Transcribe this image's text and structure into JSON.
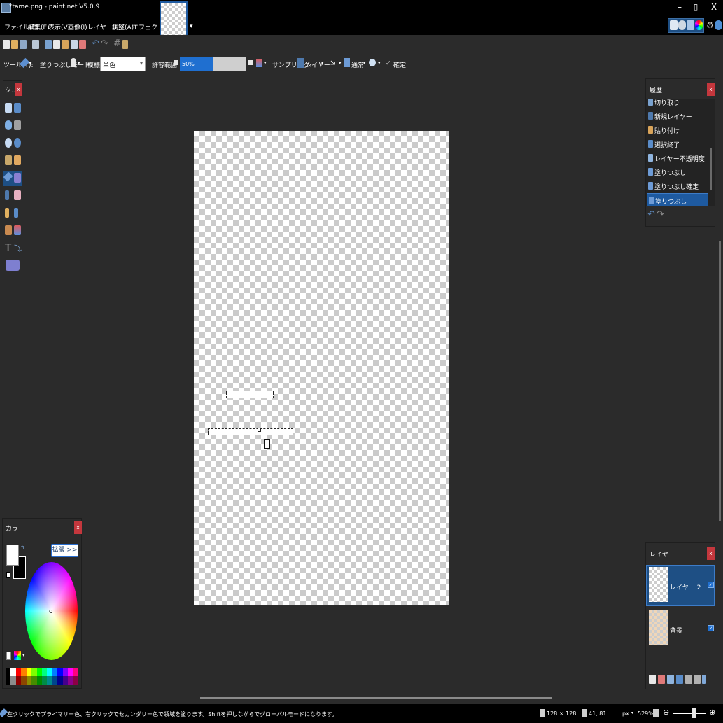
{
  "window": {
    "title": "*tame.png - paint.net V5.0.9",
    "minimize": "–",
    "restore": "▯",
    "close": "X"
  },
  "menu": [
    "ファイル(F)",
    "編集(E)",
    "表示(V)",
    "画像(I)",
    "レイヤー(L)",
    "調整(A)",
    "エフェクト(C)"
  ],
  "toolbar2": {
    "tool_label": "ツール(T):",
    "fill_mode_label": "塗りつぶしモード:",
    "pattern_label": "模様:",
    "pattern_value": "単色",
    "tolerance_label": "許容範囲:",
    "tolerance_value": "50%",
    "tolerance_fraction": 0.5,
    "sampling_label": "サンプリング:",
    "sampling_value": "レイヤー",
    "blend_value": "通常",
    "commit_label": "確定"
  },
  "tools_panel": {
    "title": "ツ..",
    "close": "x"
  },
  "history_panel": {
    "title": "履歴",
    "close": "x",
    "items": [
      "切り取り",
      "新規レイヤー",
      "貼り付け",
      "選択終了",
      "レイヤー不透明度",
      "塗りつぶし",
      "塗りつぶし確定",
      "塗りつぶし"
    ],
    "selected_index": 7,
    "undo": "↶",
    "redo": "↷"
  },
  "colors_panel": {
    "title": "カラー",
    "close": "x",
    "expand_button": "拡張 >>",
    "wheel_marker": "o",
    "palette": [
      "#000000",
      "#ffffff",
      "#ff0000",
      "#ff7f00",
      "#ffff00",
      "#7fff00",
      "#00ff00",
      "#00ff7f",
      "#00ffff",
      "#007fff",
      "#0000ff",
      "#7f00ff",
      "#ff00ff",
      "#ff007f"
    ]
  },
  "layers_panel": {
    "title": "レイヤー",
    "close": "x",
    "layers": [
      {
        "name": "レイヤー 2",
        "visible": true,
        "selected": true
      },
      {
        "name": "背景",
        "visible": true,
        "selected": false
      }
    ]
  },
  "status_bar": {
    "hint": "左クリックでプライマリー色、右クリックでセカンダリー色で領域を塗ります。Shiftを押しながらでグローバルモードになります。",
    "image_size": "128 × 128",
    "cursor_pos": "41, 81",
    "units": "px",
    "zoom": "529%"
  },
  "colors": {
    "accent": "#1f6fd0",
    "panel_bg": "#2b2b2b",
    "titlebar_bg": "#000000",
    "close_red": "#c4373d"
  }
}
